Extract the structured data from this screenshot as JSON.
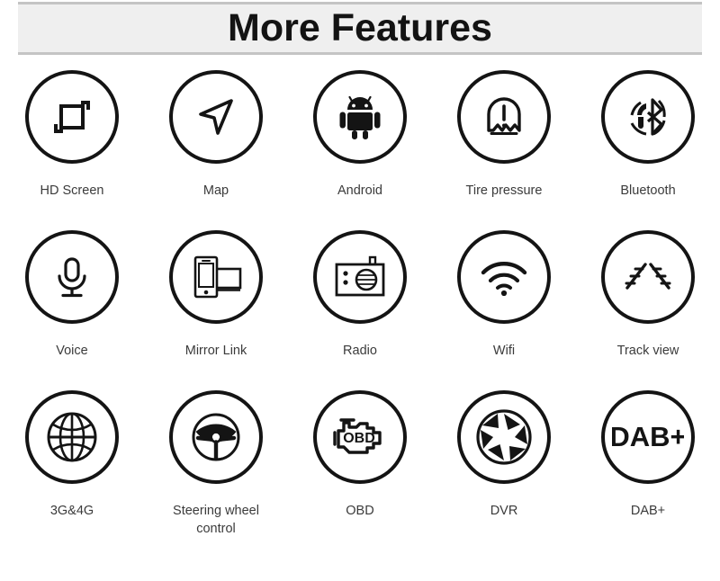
{
  "header": {
    "title": "More Features",
    "background_color": "#efefef",
    "border_color": "#c4c4c4",
    "text_color": "#131313"
  },
  "theme": {
    "icon_stroke_color": "#141414",
    "label_color": "#3b3b3b",
    "page_background": "#ffffff"
  },
  "grid": {
    "columns": 5,
    "rows": 3,
    "rows_data": [
      {
        "cells": [
          {
            "label": "HD Screen",
            "icon": "hd-screen-icon"
          },
          {
            "label": "Map",
            "icon": "navigation-arrow-icon"
          },
          {
            "label": "Android",
            "icon": "android-robot-icon"
          },
          {
            "label": "Tire pressure",
            "icon": "tire-pressure-icon"
          },
          {
            "label": "Bluetooth",
            "icon": "bluetooth-headset-icon"
          }
        ]
      },
      {
        "cells": [
          {
            "label": "Voice",
            "icon": "microphone-icon"
          },
          {
            "label": "Mirror Link",
            "icon": "mirror-link-icon"
          },
          {
            "label": "Radio",
            "icon": "radio-icon"
          },
          {
            "label": "Wifi",
            "icon": "wifi-icon"
          },
          {
            "label": "Track view",
            "icon": "track-view-icon"
          }
        ]
      },
      {
        "cells": [
          {
            "label": "3G&4G",
            "icon": "globe-icon"
          },
          {
            "label": "Steering wheel\ncontrol",
            "icon": "steering-wheel-icon"
          },
          {
            "label": "OBD",
            "icon": "obd-engine-icon"
          },
          {
            "label": "DVR",
            "icon": "camera-aperture-icon"
          },
          {
            "label": "DAB+",
            "icon": "dab-plus-icon"
          }
        ]
      }
    ]
  },
  "icon_text": {
    "obd": "OBD",
    "dab": "DAB+"
  }
}
